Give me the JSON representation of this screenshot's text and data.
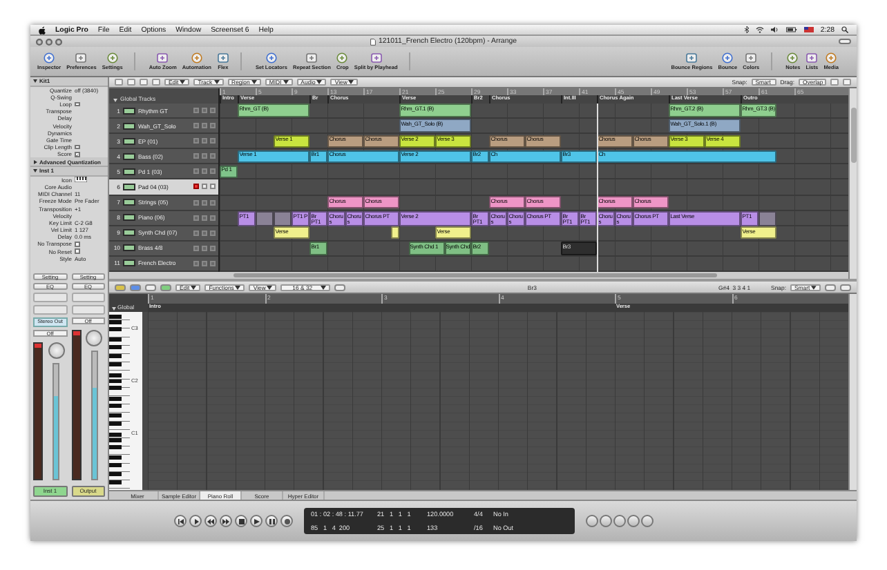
{
  "menu_bar": {
    "app": "Logic Pro",
    "items": [
      "File",
      "Edit",
      "Options",
      "Window",
      "Screenset 6",
      "Help"
    ],
    "clock": "2:28"
  },
  "window": {
    "title": "121011_French Electro (120bpm) - Arrange"
  },
  "toolbar": {
    "left": [
      [
        "Inspector",
        "Preferences",
        "Settings"
      ],
      [
        "Auto Zoom",
        "Automation",
        "Flex"
      ],
      [
        "Set Locators",
        "Repeat Section",
        "Crop",
        "Split by Playhead"
      ]
    ],
    "right": [
      [
        "Bounce Regions",
        "Bounce",
        "Colors"
      ],
      [
        "Notes",
        "Lists",
        "Media"
      ]
    ]
  },
  "inspector": {
    "sections": [
      {
        "title": "Kit1",
        "expanded": true,
        "rows": [
          {
            "kind": "value",
            "label": "Quantize",
            "value": "off (3840)"
          },
          {
            "kind": "plain",
            "label": "Q-Swing"
          },
          {
            "kind": "checkbox",
            "label": "Loop",
            "checked": false
          },
          {
            "kind": "plain",
            "label": "Transpose"
          },
          {
            "kind": "plain",
            "label": "Delay"
          },
          {
            "kind": "plain",
            "label": "Velocity"
          },
          {
            "kind": "plain",
            "label": "Dynamics"
          },
          {
            "kind": "plain",
            "label": "Gate Time"
          },
          {
            "kind": "checkbox",
            "label": "Clip Length",
            "checked": false
          },
          {
            "kind": "checkbox",
            "label": "Score",
            "checked": true
          }
        ]
      },
      {
        "title": "Advanced Quantization",
        "expanded": false
      },
      {
        "title": "Inst 1",
        "expanded": true,
        "rows": [
          {
            "kind": "icon",
            "label": "Icon"
          },
          {
            "kind": "plain",
            "label": "Core Audio"
          },
          {
            "kind": "value",
            "label": "MIDI Channel",
            "value": "11"
          },
          {
            "kind": "value",
            "label": "Freeze Mode",
            "value": "Pre Fader"
          },
          {
            "kind": "value",
            "label": "Transposition",
            "value": "+1"
          },
          {
            "kind": "plain",
            "label": "Velocity"
          },
          {
            "kind": "value",
            "label": "Key Limit",
            "value": "C-2  G8"
          },
          {
            "kind": "value",
            "label": "Vel Limit",
            "value": "1  127"
          },
          {
            "kind": "value",
            "label": "Delay",
            "value": "0.0 ms"
          },
          {
            "kind": "checkbox",
            "label": "No Transpose",
            "checked": false
          },
          {
            "kind": "checkbox",
            "label": "No Reset",
            "checked": false
          },
          {
            "kind": "value",
            "label": "Style",
            "value": "Auto"
          }
        ]
      }
    ]
  },
  "mixer_strips": [
    {
      "slots": [
        "Setting",
        "EQ"
      ],
      "io": "Stereo Out",
      "automation": "Off",
      "name": "Inst 1",
      "color": "#8fd68f",
      "level": 0.72
    },
    {
      "slots": [
        "Setting",
        "EQ"
      ],
      "automation": "Off",
      "name": "Output",
      "color": "#d9d98a",
      "level": 0.72
    }
  ],
  "arrange": {
    "menus": [
      "Edit",
      "Track",
      "Region",
      "MIDI",
      "Audio",
      "View"
    ],
    "snap_label": "Snap:",
    "snap": "Smart",
    "drag_label": "Drag:",
    "drag": "Overlap",
    "global_tracks": "Global Tracks",
    "ruler": [
      "1",
      "5",
      "9",
      "13",
      "17",
      "21",
      "25",
      "29",
      "33",
      "37",
      "41",
      "45",
      "49",
      "53",
      "57",
      "61",
      "65"
    ],
    "markers": [
      {
        "label": "Intro"
      },
      {
        "label": "Verse"
      },
      {
        "label": "Br"
      },
      {
        "label": "Chorus"
      },
      {
        "label": "Verse"
      },
      {
        "label": "Br2"
      },
      {
        "label": "Chorus"
      },
      {
        "label": "Int.III"
      },
      {
        "label": "Chorus Again"
      },
      {
        "label": "Last Verse"
      },
      {
        "label": "Outro"
      }
    ],
    "tracks": [
      {
        "number": "1",
        "name": "Rhythm GT",
        "selected": false,
        "armed": false,
        "regions": [
          {
            "label": "Rhm_GT (B)",
            "color": "#8fcf8f"
          },
          {
            "label": "Rhm_GT.1 (B)",
            "color": "#8fcf8f"
          },
          {
            "label": "Rhm_GT.2 (B)",
            "color": "#8fcf8f"
          },
          {
            "label": "Rhm_GT.3 (B)",
            "color": "#8fcf8f"
          }
        ]
      },
      {
        "number": "2",
        "name": "Wah_GT_Solo",
        "selected": false,
        "armed": false,
        "regions": [
          {
            "label": "Wah_GT_Solo (B)",
            "color": "#8fa8c4"
          },
          {
            "label": "Wah_GT_Solo.1 (B)",
            "color": "#8fa8c4"
          }
        ]
      },
      {
        "number": "3",
        "name": "EP (01)",
        "selected": false,
        "armed": false,
        "regions": [
          {
            "label": "Verse 1",
            "color": "#c9e43f"
          },
          {
            "label": "Chorus",
            "color": "#b99d80"
          },
          {
            "label": "Chorus",
            "color": "#b99d80"
          },
          {
            "label": "Verse 2",
            "color": "#c9e43f"
          },
          {
            "label": "Verse 3",
            "color": "#c9e43f"
          },
          {
            "label": "Chorus",
            "color": "#b99d80"
          },
          {
            "label": "Chorus",
            "color": "#b99d80"
          },
          {
            "label": "Chorus",
            "color": "#b99d80"
          },
          {
            "label": "Chorus",
            "color": "#b99d80"
          },
          {
            "label": "Verse 3",
            "color": "#c9e43f"
          },
          {
            "label": "Verse 4",
            "color": "#c9e43f"
          }
        ]
      },
      {
        "number": "4",
        "name": "Bass (02)",
        "selected": false,
        "armed": false,
        "regions": [
          {
            "label": "Verse 1",
            "color": "#4fc4e8"
          },
          {
            "label": "Br1",
            "color": "#4fc4e8"
          },
          {
            "label": "Chorus",
            "color": "#4fc4e8"
          },
          {
            "label": "Verse 2",
            "color": "#4fc4e8"
          },
          {
            "label": "Br2",
            "color": "#4fc4e8"
          },
          {
            "label": "Ch",
            "color": "#4fc4e8"
          },
          {
            "label": "Br3",
            "color": "#4fc4e8"
          },
          {
            "label": "Ch",
            "color": "#4fc4e8"
          }
        ]
      },
      {
        "number": "5",
        "name": "Pd 1 (03)",
        "selected": false,
        "armed": false,
        "regions": [
          {
            "label": "Pd 1",
            "color": "#7fc48a"
          }
        ]
      },
      {
        "number": "6",
        "name": "Pad 04 (03)",
        "selected": true,
        "armed": true
      },
      {
        "number": "7",
        "name": "Strings (05)",
        "selected": false,
        "armed": false,
        "regions": [
          {
            "label": "Chorus",
            "color": "#ee95c6"
          },
          {
            "label": "Chorus",
            "color": "#ee95c6"
          },
          {
            "label": "Chorus",
            "color": "#ee95c6"
          },
          {
            "label": "Chorus",
            "color": "#ee95c6"
          },
          {
            "label": "Chorus",
            "color": "#ee95c6"
          },
          {
            "label": "Chorus",
            "color": "#ee95c6"
          }
        ]
      },
      {
        "number": "8",
        "name": "Piano (06)",
        "selected": false,
        "armed": false,
        "regions": [
          {
            "label": "PT1",
            "color": "#b88ee6"
          },
          {
            "color": "#8a8296"
          },
          {
            "color": "#8a8296"
          },
          {
            "label": "PT1 P",
            "color": "#b88ee6"
          },
          {
            "label": "Br PT1",
            "color": "#b88ee6"
          },
          {
            "label": "Chorus",
            "color": "#b88ee6"
          },
          {
            "label": "Chorus",
            "color": "#b88ee6"
          },
          {
            "label": "Chorus PT",
            "color": "#b88ee6"
          },
          {
            "label": "Verse 2",
            "color": "#b88ee6"
          },
          {
            "label": "Br PT1",
            "color": "#b88ee6"
          },
          {
            "label": "Chorus",
            "color": "#b88ee6"
          },
          {
            "label": "Chorus",
            "color": "#b88ee6"
          },
          {
            "label": "Chorus PT",
            "color": "#b88ee6"
          },
          {
            "label": "Br PT1",
            "color": "#b88ee6"
          },
          {
            "label": "Br PT1",
            "color": "#b88ee6"
          },
          {
            "label": "Chorus",
            "color": "#b88ee6"
          },
          {
            "label": "Chorus",
            "color": "#b88ee6"
          },
          {
            "label": "Chorus PT",
            "color": "#b88ee6"
          },
          {
            "label": "Last Verse",
            "color": "#b88ee6"
          },
          {
            "label": "PT1",
            "color": "#b88ee6"
          },
          {
            "color": "#8a8296"
          }
        ]
      },
      {
        "number": "9",
        "name": "Synth Chd (07)",
        "selected": false,
        "armed": false,
        "regions": [
          {
            "label": "Verse",
            "color": "#f0f08c"
          },
          {
            "color": "#f0f08c"
          },
          {
            "label": "Verse",
            "color": "#f0f08c"
          },
          {
            "label": "Verse",
            "color": "#f0f08c"
          }
        ]
      },
      {
        "number": "10",
        "name": "Brass 4/8",
        "selected": false,
        "armed": false,
        "regions": [
          {
            "label": "Br1",
            "color": "#7fbf84"
          },
          {
            "label": "Synth Chd 1",
            "color": "#7fbf84"
          },
          {
            "label": "Synth Chd",
            "color": "#7fbf84"
          },
          {
            "label": "Br2",
            "color": "#7fbf84"
          },
          {
            "label": "Br3",
            "color": "#2e2e2e"
          }
        ]
      },
      {
        "number": "11",
        "name": "French Electro",
        "selected": false,
        "armed": false
      }
    ]
  },
  "piano_roll": {
    "menus": [
      "Edit",
      "Functions",
      "View"
    ],
    "quantize": "16 & 32",
    "region": "Br3",
    "position": "G#4  3 3 4 1",
    "snap_label": "Snap:",
    "snap": "Smart",
    "global": "Global",
    "ruler": [
      "1",
      "2",
      "3",
      "4",
      "5",
      "6"
    ],
    "markers": [
      {
        "label": "Intro"
      },
      {
        "label": "Verse"
      }
    ],
    "keys": [
      "C3",
      "C2",
      "C1"
    ]
  },
  "editor_tabs": [
    {
      "label": "Mixer",
      "selected": false
    },
    {
      "label": "Sample Editor",
      "selected": false
    },
    {
      "label": "Piano Roll",
      "selected": true
    },
    {
      "label": "Score",
      "selected": false
    },
    {
      "label": "Hyper Editor",
      "selected": false
    }
  ],
  "transport": {
    "lcd": [
      [
        "01 : 02 : 48 : 11.77",
        "21   1   1   1",
        "120.0000",
        "4/4",
        "No In"
      ],
      [
        "85   1   4  200",
        "25   1   1   1",
        "133",
        "/16",
        "No Out"
      ]
    ]
  }
}
